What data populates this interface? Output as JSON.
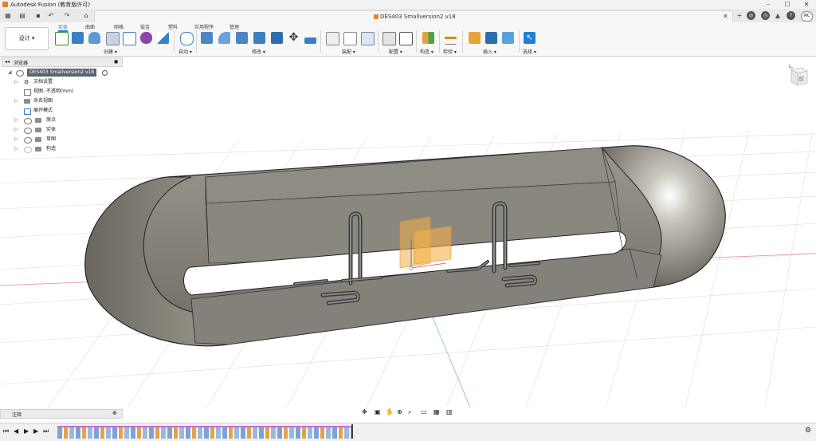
{
  "app": {
    "title": "Autodesk Fusion (教育版许可)"
  },
  "document": {
    "tab_title": "DES403 Smallversion2 v18"
  },
  "user": {
    "initials": "MC"
  },
  "workspace": {
    "label": "设计 ▾"
  },
  "ribbon": {
    "tabs": [
      "实体",
      "曲面",
      "网格",
      "钣金",
      "塑料",
      "实用程序",
      "管理"
    ],
    "active_tab": "实体",
    "groups": [
      {
        "label": "创建 ▾"
      },
      {
        "label": "自动 ▾"
      },
      {
        "label": "修改 ▾"
      },
      {
        "label": "装配 ▾"
      },
      {
        "label": "配置 ▾"
      },
      {
        "label": "构造 ▾"
      },
      {
        "label": "检验 ▾"
      },
      {
        "label": "插入 ▾"
      },
      {
        "label": "选择 ▾"
      }
    ]
  },
  "browser": {
    "header": "浏览器",
    "root": "DES403 Smallversion2 v18",
    "items": [
      {
        "label": "文档设置",
        "icon": "gear-icon"
      },
      {
        "label": "视图: 不透明(mm)",
        "icon": "units-icon"
      },
      {
        "label": "命名视图",
        "icon": "folder-icon"
      },
      {
        "label": "展开模式",
        "icon": "layout-icon"
      },
      {
        "label": "原点",
        "icon": "folder-icon"
      },
      {
        "label": "实体",
        "icon": "folder-icon"
      },
      {
        "label": "草图",
        "icon": "folder-icon"
      },
      {
        "label": "构造",
        "icon": "folder-icon"
      }
    ]
  },
  "viewcube": {
    "face": "前"
  },
  "comments": {
    "label": "注释"
  },
  "colors": {
    "accent": "#1e7fd6",
    "selection": "#2e86d8",
    "ground_grid": "#d7d9dd"
  }
}
